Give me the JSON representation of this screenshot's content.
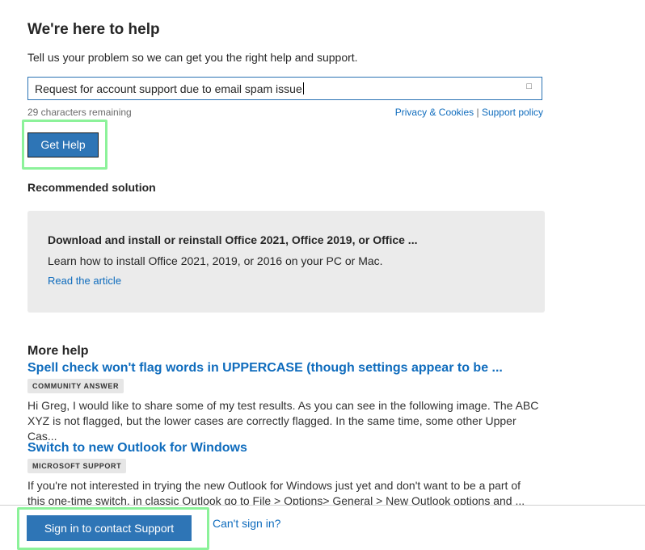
{
  "header": {
    "title": "We're here to help",
    "subtitle": "Tell us your problem so we can get you the right help and support."
  },
  "query": {
    "value": "Request for account support due to email spam issue",
    "clear_glyph": "□",
    "chars_remaining": "29 characters remaining",
    "privacy_link": "Privacy & Cookies",
    "separator": "|",
    "support_policy_link": "Support policy"
  },
  "get_help_label": "Get Help",
  "recommended": {
    "heading": "Recommended solution",
    "title": "Download and install or reinstall Office 2021, Office 2019, or Office ...",
    "description": "Learn how to install Office 2021, 2019, or 2016 on your PC or Mac.",
    "link": "Read the article"
  },
  "more_help": {
    "heading": "More help",
    "articles": [
      {
        "title": "Spell check won't flag words in UPPERCASE (though settings appear to be ...",
        "badge": "COMMUNITY ANSWER",
        "excerpt_line1": "Hi Greg, I would like to share some of my test results. As you can see in the following image. The ABC",
        "excerpt_line2": "XYZ is not flagged, but the lower cases are correctly flagged. In the same time, some other Upper Cas..."
      },
      {
        "title": "Switch to new Outlook for Windows",
        "badge": "MICROSOFT SUPPORT",
        "excerpt_line1": "If you're not interested in trying the new Outlook for Windows just yet and don't want to be a part of",
        "excerpt_line2": "this one-time switch, in classic Outlook go to File > Options> General > New Outlook options and ..."
      }
    ]
  },
  "footer": {
    "sign_in_label": "Sign in to contact Support",
    "cant_sign_in": "Can't sign in?"
  },
  "colors": {
    "accent": "#2e75b6",
    "link": "#0f6cbd",
    "highlight": "#8cf29a"
  }
}
